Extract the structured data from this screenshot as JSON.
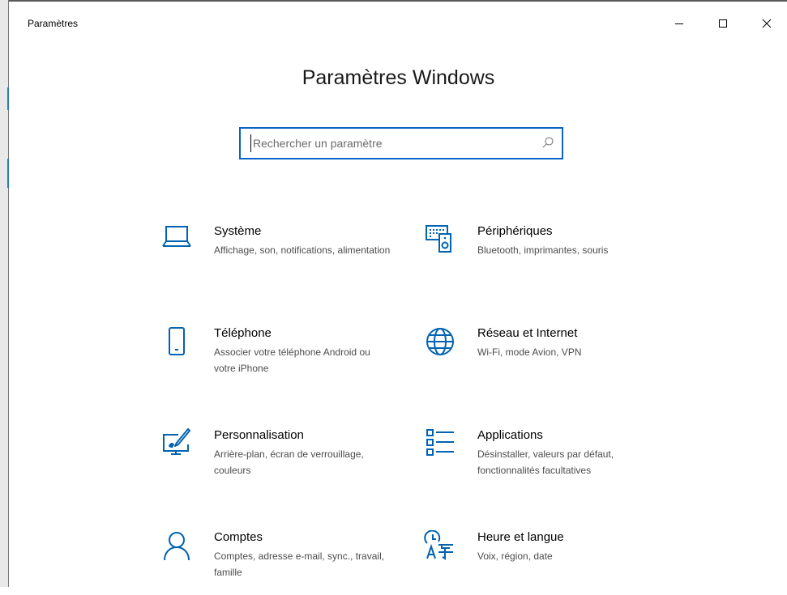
{
  "window": {
    "title": "Paramètres",
    "controls": [
      "minimize-icon",
      "maximize-icon",
      "close-icon"
    ]
  },
  "heading": "Paramètres Windows",
  "search": {
    "placeholder": "Rechercher un paramètre",
    "value": "",
    "icon": "search-icon"
  },
  "colors": {
    "accent": "#0a64c8",
    "icon": "#0063b1",
    "description": "#4c4c4c"
  },
  "categories": [
    {
      "name": "Système",
      "description": "Affichage, son, notifications, alimentation",
      "icon": "laptop-icon"
    },
    {
      "name": "Périphériques",
      "description": "Bluetooth, imprimantes, souris",
      "icon": "devices-icon"
    },
    {
      "name": "Téléphone",
      "description": "Associer votre téléphone Android ou votre iPhone",
      "icon": "phone-icon"
    },
    {
      "name": "Réseau et Internet",
      "description": "Wi-Fi, mode Avion, VPN",
      "icon": "globe-icon"
    },
    {
      "name": "Personnalisation",
      "description": "Arrière-plan, écran de verrouillage, couleurs",
      "icon": "personalization-icon"
    },
    {
      "name": "Applications",
      "description": "Désinstaller, valeurs par défaut, fonctionnalités facultatives",
      "icon": "apps-list-icon"
    },
    {
      "name": "Comptes",
      "description": "Comptes, adresse e-mail, sync., travail, famille",
      "icon": "person-icon"
    },
    {
      "name": "Heure et langue",
      "description": "Voix, région, date",
      "icon": "time-language-icon"
    }
  ]
}
